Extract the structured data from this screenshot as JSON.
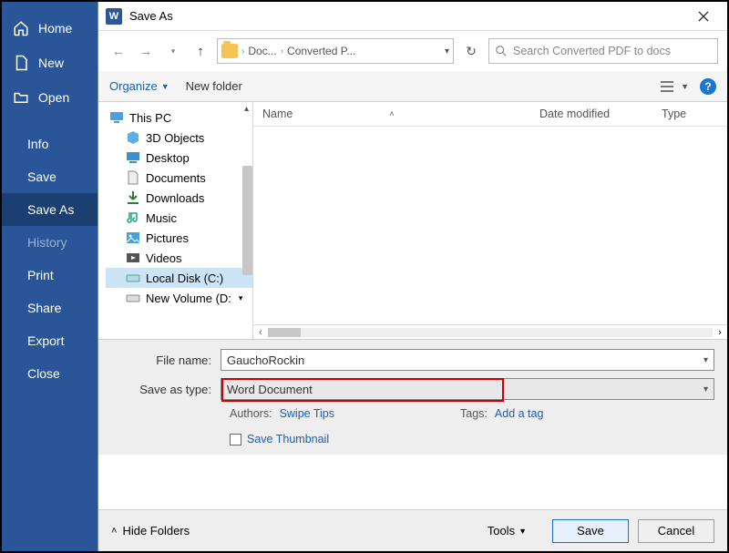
{
  "word_sidebar": {
    "home": "Home",
    "new": "New",
    "open": "Open",
    "info": "Info",
    "save": "Save",
    "save_as": "Save As",
    "history": "History",
    "print": "Print",
    "share": "Share",
    "export": "Export",
    "close": "Close"
  },
  "dialog": {
    "title": "Save As",
    "breadcrumb": {
      "part1": "Doc...",
      "part2": "Converted P..."
    },
    "search_placeholder": "Search Converted PDF to docs",
    "organize": "Organize",
    "new_folder": "New folder",
    "columns": {
      "name": "Name",
      "date": "Date modified",
      "type": "Type"
    },
    "tree": {
      "this_pc": "This PC",
      "objects3d": "3D Objects",
      "desktop": "Desktop",
      "documents": "Documents",
      "downloads": "Downloads",
      "music": "Music",
      "pictures": "Pictures",
      "videos": "Videos",
      "local_disk": "Local Disk (C:)",
      "new_volume": "New Volume (D:"
    },
    "form": {
      "file_name_label": "File name:",
      "file_name_value": "GauchoRockin",
      "save_type_label": "Save as type:",
      "save_type_value": "Word Document",
      "authors_label": "Authors:",
      "authors_value": "Swipe Tips",
      "tags_label": "Tags:",
      "tags_value": "Add a tag",
      "save_thumbnail": "Save Thumbnail"
    },
    "footer": {
      "hide_folders": "Hide Folders",
      "tools": "Tools",
      "save": "Save",
      "cancel": "Cancel"
    }
  }
}
